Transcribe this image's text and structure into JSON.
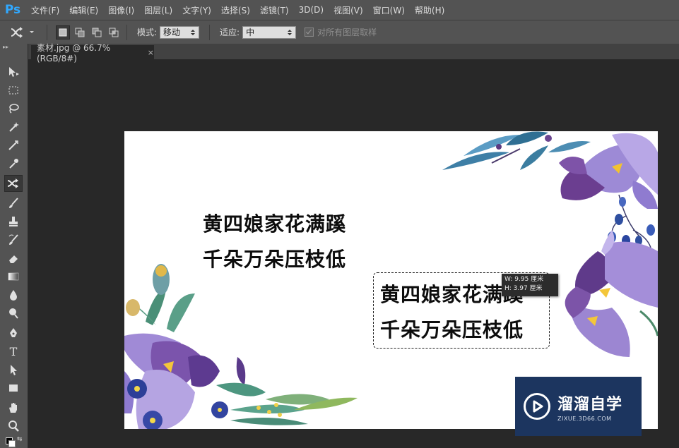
{
  "app": {
    "logo": "Ps"
  },
  "menu": [
    "文件(F)",
    "编辑(E)",
    "图像(I)",
    "图层(L)",
    "文字(Y)",
    "选择(S)",
    "滤镜(T)",
    "3D(D)",
    "视图(V)",
    "窗口(W)",
    "帮助(H)"
  ],
  "options": {
    "mode_label": "模式:",
    "mode_value": "移动",
    "adapt_label": "适应:",
    "adapt_value": "中",
    "sample_all_layers": "对所有图层取样"
  },
  "document_tab": {
    "title": "素材.jpg @ 66.7%(RGB/8#)",
    "close": "×"
  },
  "canvas": {
    "poem_original": [
      "黄四娘家花满蹊",
      "千朵万朵压枝低"
    ],
    "poem_selected": [
      "黄四娘家花满蹊",
      "千朵万朵压枝低"
    ],
    "measure": {
      "width": "W: 9.95 厘米",
      "height": "H: 3.97 厘米"
    }
  },
  "watermark": {
    "brand": "溜溜自学",
    "url": "ZIXUE.3D66.COM"
  },
  "colors": {
    "ps_blue": "#31a8ff",
    "panel": "#535353",
    "workspace": "#282828",
    "watermark_bg": "#1c355f"
  },
  "tools": [
    "move-tool",
    "marquee-tool",
    "lasso-tool",
    "magic-wand-tool",
    "crop-tool",
    "eyedropper-tool",
    "content-aware-move-tool",
    "brush-tool",
    "clone-stamp-tool",
    "history-brush-tool",
    "eraser-tool",
    "gradient-tool",
    "blur-tool",
    "dodge-tool",
    "pen-tool",
    "type-tool",
    "path-selection-tool",
    "rectangle-tool",
    "hand-tool",
    "zoom-tool"
  ]
}
